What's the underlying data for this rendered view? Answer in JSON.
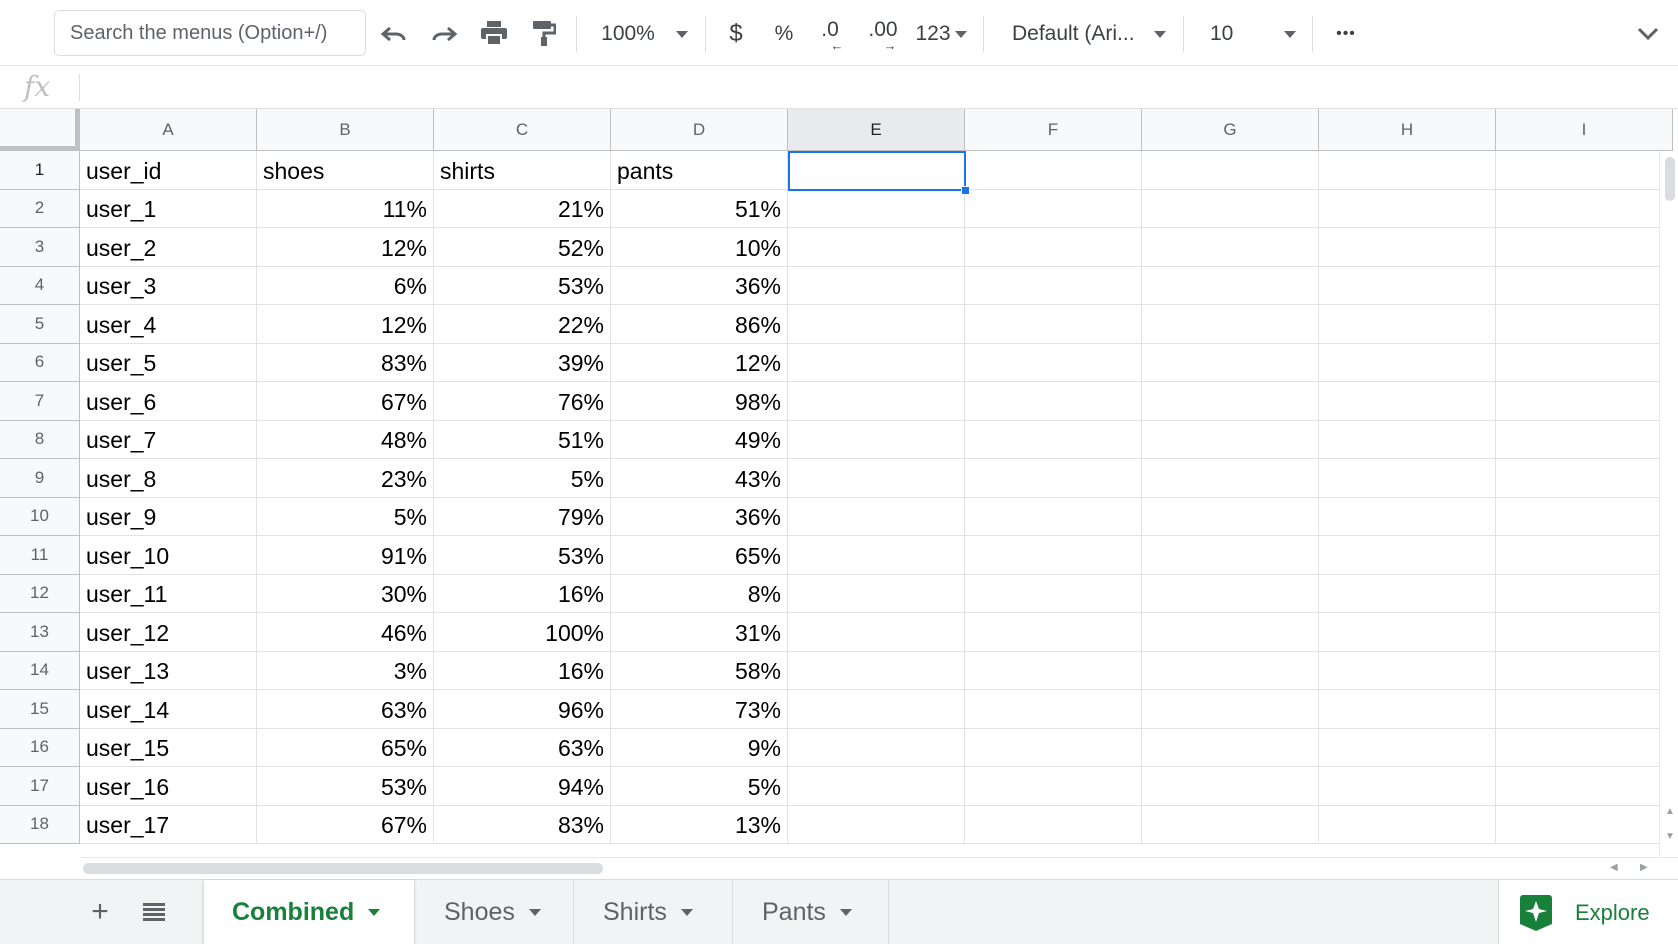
{
  "toolbar": {
    "search_placeholder": "Search the menus (Option+/)",
    "zoom": "100%",
    "currency": "$",
    "percent": "%",
    "decrease_decimal": ".0",
    "increase_decimal": ".00",
    "number_format": "123",
    "font": "Default (Ari...",
    "font_size": "10",
    "more": "•••"
  },
  "formula_bar": {
    "fx_label": "fx",
    "value": ""
  },
  "columns": [
    "A",
    "B",
    "C",
    "D",
    "E",
    "F",
    "G",
    "H",
    "I"
  ],
  "selected_column": "E",
  "rows": [
    {
      "n": "1",
      "cells": [
        "user_id",
        "shoes",
        "shirts",
        "pants"
      ]
    },
    {
      "n": "2",
      "cells": [
        "user_1",
        "11%",
        "21%",
        "51%"
      ]
    },
    {
      "n": "3",
      "cells": [
        "user_2",
        "12%",
        "52%",
        "10%"
      ]
    },
    {
      "n": "4",
      "cells": [
        "user_3",
        "6%",
        "53%",
        "36%"
      ]
    },
    {
      "n": "5",
      "cells": [
        "user_4",
        "12%",
        "22%",
        "86%"
      ]
    },
    {
      "n": "6",
      "cells": [
        "user_5",
        "83%",
        "39%",
        "12%"
      ]
    },
    {
      "n": "7",
      "cells": [
        "user_6",
        "67%",
        "76%",
        "98%"
      ]
    },
    {
      "n": "8",
      "cells": [
        "user_7",
        "48%",
        "51%",
        "49%"
      ]
    },
    {
      "n": "9",
      "cells": [
        "user_8",
        "23%",
        "5%",
        "43%"
      ]
    },
    {
      "n": "10",
      "cells": [
        "user_9",
        "5%",
        "79%",
        "36%"
      ]
    },
    {
      "n": "11",
      "cells": [
        "user_10",
        "91%",
        "53%",
        "65%"
      ]
    },
    {
      "n": "12",
      "cells": [
        "user_11",
        "30%",
        "16%",
        "8%"
      ]
    },
    {
      "n": "13",
      "cells": [
        "user_12",
        "46%",
        "100%",
        "31%"
      ]
    },
    {
      "n": "14",
      "cells": [
        "user_13",
        "3%",
        "16%",
        "58%"
      ]
    },
    {
      "n": "15",
      "cells": [
        "user_14",
        "63%",
        "96%",
        "73%"
      ]
    },
    {
      "n": "16",
      "cells": [
        "user_15",
        "65%",
        "63%",
        "9%"
      ]
    },
    {
      "n": "17",
      "cells": [
        "user_16",
        "53%",
        "94%",
        "5%"
      ]
    },
    {
      "n": "18",
      "cells": [
        "user_17",
        "67%",
        "83%",
        "13%"
      ]
    }
  ],
  "sheets": [
    {
      "label": "Combined",
      "active": true
    },
    {
      "label": "Shoes",
      "active": false
    },
    {
      "label": "Shirts",
      "active": false
    },
    {
      "label": "Pants",
      "active": false
    }
  ],
  "explore_label": "Explore",
  "colors": {
    "accent": "#188038",
    "selection": "#1a73e8"
  }
}
